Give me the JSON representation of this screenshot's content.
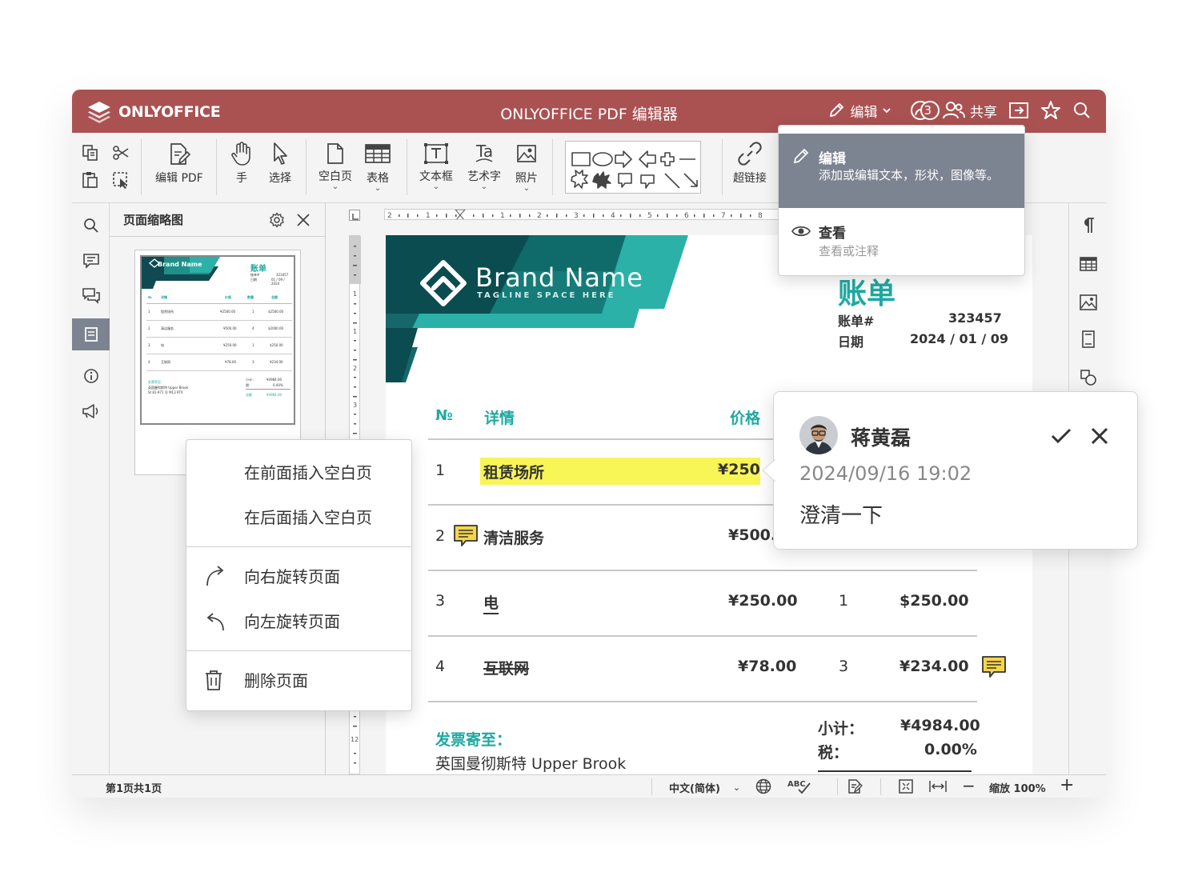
{
  "app": {
    "logo_text": "ONLYOFFICE",
    "title": "ONLYOFFICE PDF 编辑器",
    "mode_label": "编辑",
    "users_count": "3",
    "share_label": "共享"
  },
  "toolbar": {
    "edit_pdf": "编辑 PDF",
    "hand": "手",
    "select": "选择",
    "blank_page": "空白页",
    "table": "表格",
    "text_box": "文本框",
    "art_text": "艺术字",
    "photo": "照片",
    "hyperlink": "超链接"
  },
  "mode_menu": {
    "edit_title": "编辑",
    "edit_desc": "添加或编辑文本，形状，图像等。",
    "view_title": "查看",
    "view_desc": "查看或注释"
  },
  "thumbnails": {
    "title": "页面缩略图"
  },
  "context_menu": {
    "insert_before": "在前面插入空白页",
    "insert_after": "在后面插入空白页",
    "rotate_right": "向右旋转页面",
    "rotate_left": "向左旋转页面",
    "delete_page": "删除页面"
  },
  "invoice": {
    "brand": "Brand Name",
    "tagline": "TAGLINE SPACE HERE",
    "title": "账单",
    "number_label": "账单#",
    "number": "323457",
    "date_label": "日期",
    "date": "2024 / 01 / 09",
    "headers": {
      "no": "№",
      "detail": "详情",
      "price": "价格"
    },
    "rows": [
      {
        "no": "1",
        "detail": "租赁场所",
        "price": "¥250"
      },
      {
        "no": "2",
        "detail": "清洁服务",
        "price": "¥500."
      },
      {
        "no": "3",
        "detail": "电",
        "price": "¥250.00",
        "qty": "1",
        "total": "$250.00"
      },
      {
        "no": "4",
        "detail": "互联网",
        "price": "¥78.00",
        "qty": "3",
        "total": "¥234.00"
      }
    ],
    "bill_to_label": "发票寄至：",
    "bill_to_address": "英国曼彻斯特 Upper Brook",
    "subtotal_label": "小计：",
    "subtotal": "¥4984.00",
    "tax_label": "税：",
    "tax": "0.00%"
  },
  "thumb_invoice": {
    "brand": "Brand Name",
    "title": "账单",
    "number_label": "账单#",
    "number": "323457",
    "date_label": "日期",
    "date": "01 / 09 / 2024",
    "h_no": "№",
    "h_detail": "详情",
    "h_price": "价格",
    "h_qty": "数量",
    "h_total": "总额",
    "rows": [
      {
        "no": "1",
        "detail": "租赁场所",
        "price": "¥2500.00",
        "qty": "1",
        "total": "$2500.00"
      },
      {
        "no": "2",
        "detail": "清洁服务",
        "price": "¥500.00",
        "qty": "4",
        "total": "$2000.00"
      },
      {
        "no": "3",
        "detail": "电",
        "price": "¥250.00",
        "qty": "1",
        "total": "$250.00"
      },
      {
        "no": "4",
        "detail": "互联网",
        "price": "¥78.00",
        "qty": "3",
        "total": "¥234.00"
      }
    ],
    "bill_to": "发票寄至：",
    "addr1": "英国曼彻斯特 Upper Brook",
    "addr2": "St 81-971 号 M13 9TX",
    "subtotal_label": "小计：",
    "subtotal": "¥4984.00",
    "tax_label": "税：",
    "tax": "0.00%",
    "total_label": "总额",
    "total": "¥4984.00"
  },
  "comment": {
    "author": "蒋黄磊",
    "time": "2024/09/16 19:02",
    "text": "澄清一下"
  },
  "status": {
    "page_info": "第1页共1页",
    "language": "中文(简体)",
    "zoom": "缩放 100%"
  },
  "ruler": {
    "h_marks": [
      "2",
      "1",
      "1",
      "2",
      "3",
      "4",
      "5",
      "6",
      "7",
      "8"
    ],
    "v_marks": [
      "1",
      "1",
      "2",
      "3",
      "12"
    ]
  },
  "colors": {
    "titlebar": "#aa5252",
    "accent_teal": "#1fa9a2",
    "highlight": "#f8f556",
    "comment_icon": "#f5d54a",
    "active_tab": "#7d8491"
  }
}
